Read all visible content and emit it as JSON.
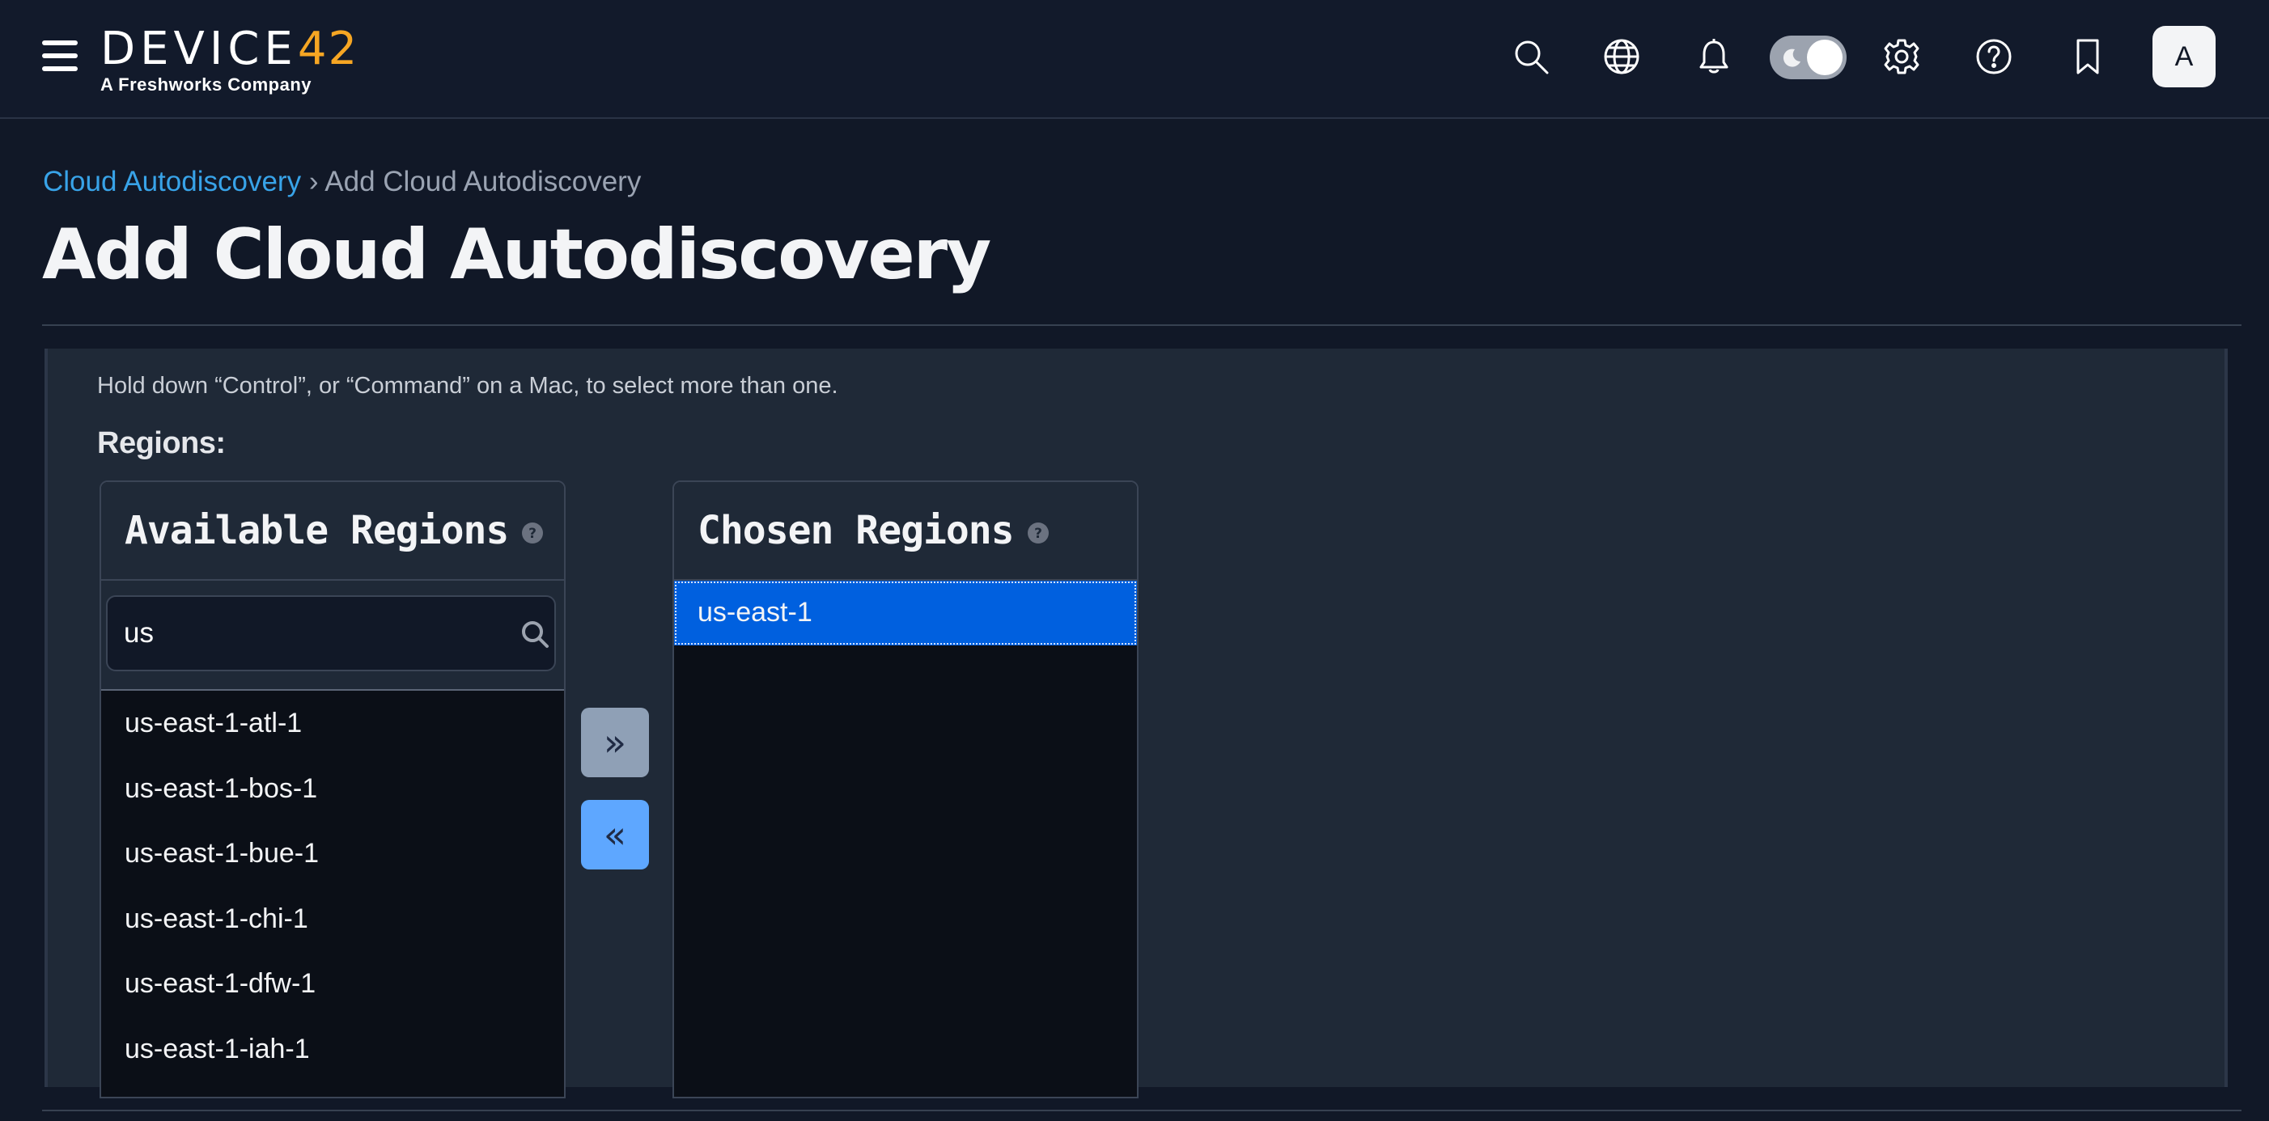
{
  "brand": {
    "logo_main": "DEVICE",
    "logo_accent": "42",
    "logo_sub": "A Freshworks Company"
  },
  "topbar": {
    "icons": [
      "menu-icon",
      "search-icon",
      "globe-icon",
      "bell-icon",
      "theme-toggle",
      "gear-icon",
      "help-icon",
      "bookmark-icon"
    ],
    "avatar_initial": "A"
  },
  "breadcrumb": {
    "parent": "Cloud Autodiscovery",
    "separator": "›",
    "current": "Add Cloud Autodiscovery"
  },
  "page": {
    "title": "Add Cloud Autodiscovery"
  },
  "form": {
    "help_text": "Hold down “Control”, or “Command” on a Mac, to select more than one.",
    "regions_label": "Regions:",
    "available": {
      "title": "Available Regions",
      "filter_value": "us",
      "options": [
        "us-east-1-atl-1",
        "us-east-1-bos-1",
        "us-east-1-bue-1",
        "us-east-1-chi-1",
        "us-east-1-dfw-1",
        "us-east-1-iah-1"
      ]
    },
    "chosen": {
      "title": "Chosen Regions",
      "options": [
        "us-east-1"
      ],
      "selected": "us-east-1"
    },
    "buttons": {
      "add_label": "»",
      "remove_label": "«"
    }
  },
  "colors": {
    "page_bg": "#111827",
    "topbar_bg": "#121a2b",
    "panel_bg": "#1f2937",
    "link": "#38a3e8",
    "logo_accent": "#f6a623",
    "selected_option": "#0060df",
    "add_button": "#8fa0b6",
    "remove_button": "#5ea7ff"
  }
}
